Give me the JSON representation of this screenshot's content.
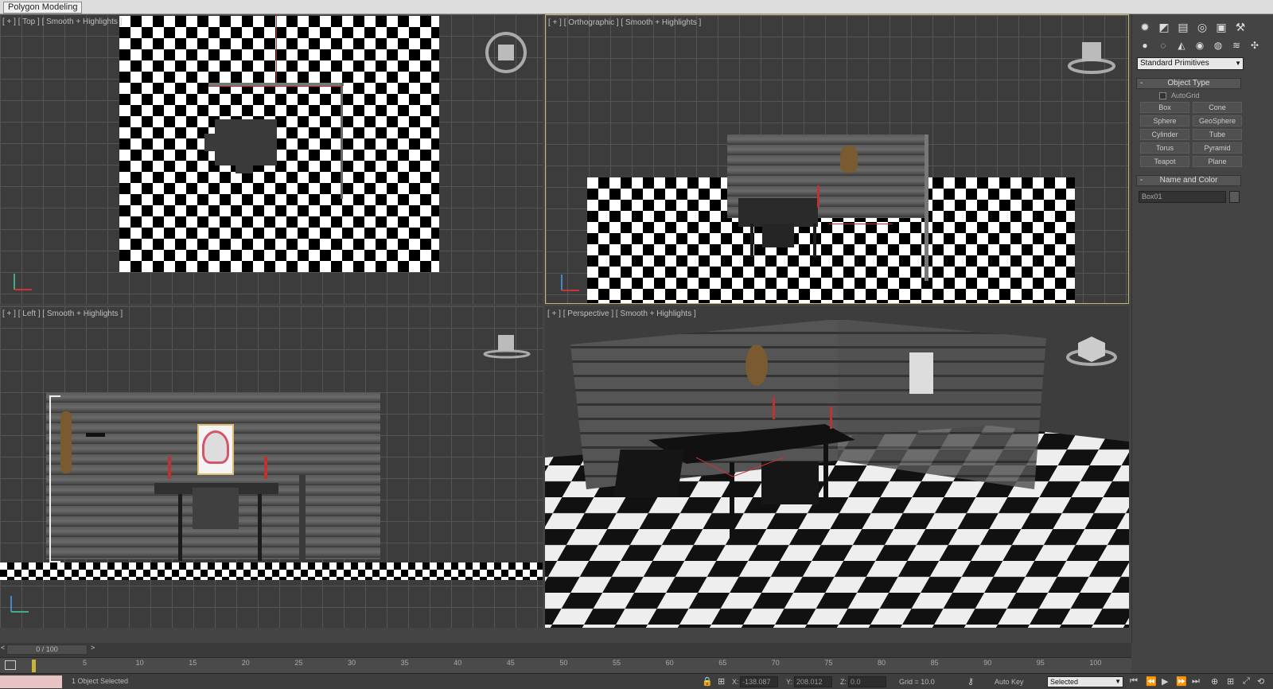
{
  "titlebar": {
    "ribbon_tab": "Polygon Modeling"
  },
  "viewports": {
    "top": {
      "label": "[ + ] [ Top ] [ Smooth + Highlights ]"
    },
    "front": {
      "label": "[ + ] [ Orthographic ] [ Smooth + Highlights ]"
    },
    "left": {
      "label": "[ + ] [ Left ] [ Smooth + Highlights ]"
    },
    "perspective": {
      "label": "[ + ] [ Perspective ] [ Smooth + Highlights ]"
    }
  },
  "command_panel": {
    "tabs": [
      "create-icon",
      "modify-icon",
      "hierarchy-icon",
      "motion-icon",
      "display-icon",
      "utilities-icon"
    ],
    "category_dropdown": "Standard Primitives",
    "object_type": {
      "title": "Object Type",
      "autogrid": "AutoGrid",
      "buttons": [
        "Box",
        "Cone",
        "Sphere",
        "GeoSphere",
        "Cylinder",
        "Tube",
        "Torus",
        "Pyramid",
        "Teapot",
        "Plane"
      ]
    },
    "name_and_color": {
      "title": "Name and Color",
      "name": "Box01"
    }
  },
  "timeline": {
    "slider": "0 / 100",
    "next": ">",
    "prev": "<",
    "ticks": [
      "5",
      "10",
      "15",
      "20",
      "25",
      "30",
      "35",
      "40",
      "45",
      "50",
      "55",
      "60",
      "65",
      "70",
      "75",
      "80",
      "85",
      "90",
      "95",
      "100"
    ]
  },
  "statusbar": {
    "selection": "1 Object Selected",
    "x_label": "X:",
    "x_value": "-138.087",
    "y_label": "Y:",
    "y_value": "208.012",
    "z_label": "Z:",
    "z_value": "0.0",
    "grid": "Grid = 10.0",
    "auto_key": "Auto Key",
    "selected": "Selected"
  }
}
